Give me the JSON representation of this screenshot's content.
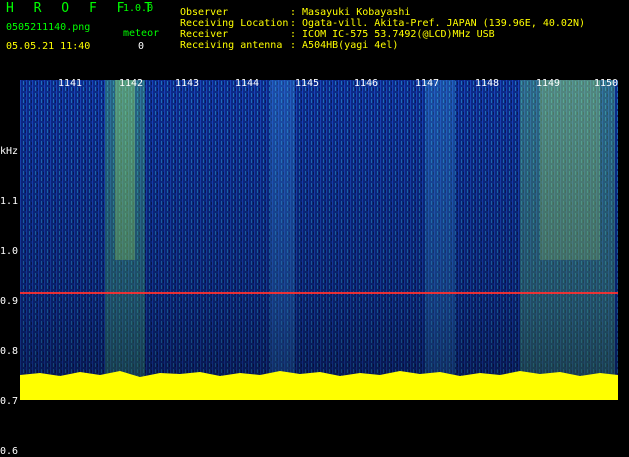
{
  "header": {
    "app_title": "H R O F F T",
    "version": "1.0.0",
    "filename": "0505211140.png",
    "datetime": "05.05.21 11:40",
    "meteor_label": "meteor",
    "meteor_count": "0",
    "observer_label": "Observer",
    "observer_value": ": Masayuki Kobayashi",
    "location_label": "Receiving Location",
    "location_value": ": Ogata-vill. Akita-Pref. JAPAN (139.96E, 40.02N)",
    "receiver_label": "Receiver",
    "receiver_value": ": ICOM IC-575 53.7492(@LCD)MHz USB",
    "antenna_label": "Receiving antenna",
    "antenna_value": ": A504HB(yagi 4el)"
  },
  "axis": {
    "unit": "kHz",
    "y_ticks": [
      "1.1",
      "1.0",
      "0.9",
      "0.8",
      "0.7",
      "0.6"
    ],
    "x_ticks": [
      "1141",
      "1142",
      "1143",
      "1144",
      "1145",
      "1146",
      "1147",
      "1148",
      "1149",
      "1150"
    ]
  },
  "colors": {
    "background": "#000000",
    "header_green": "#00ff00",
    "header_yellow": "#ffff00",
    "spectrum_low": "#0a1a6a",
    "spectrum_high": "#7fe080",
    "carrier_line": "#ff3030",
    "noise_floor": "#ffff00"
  }
}
